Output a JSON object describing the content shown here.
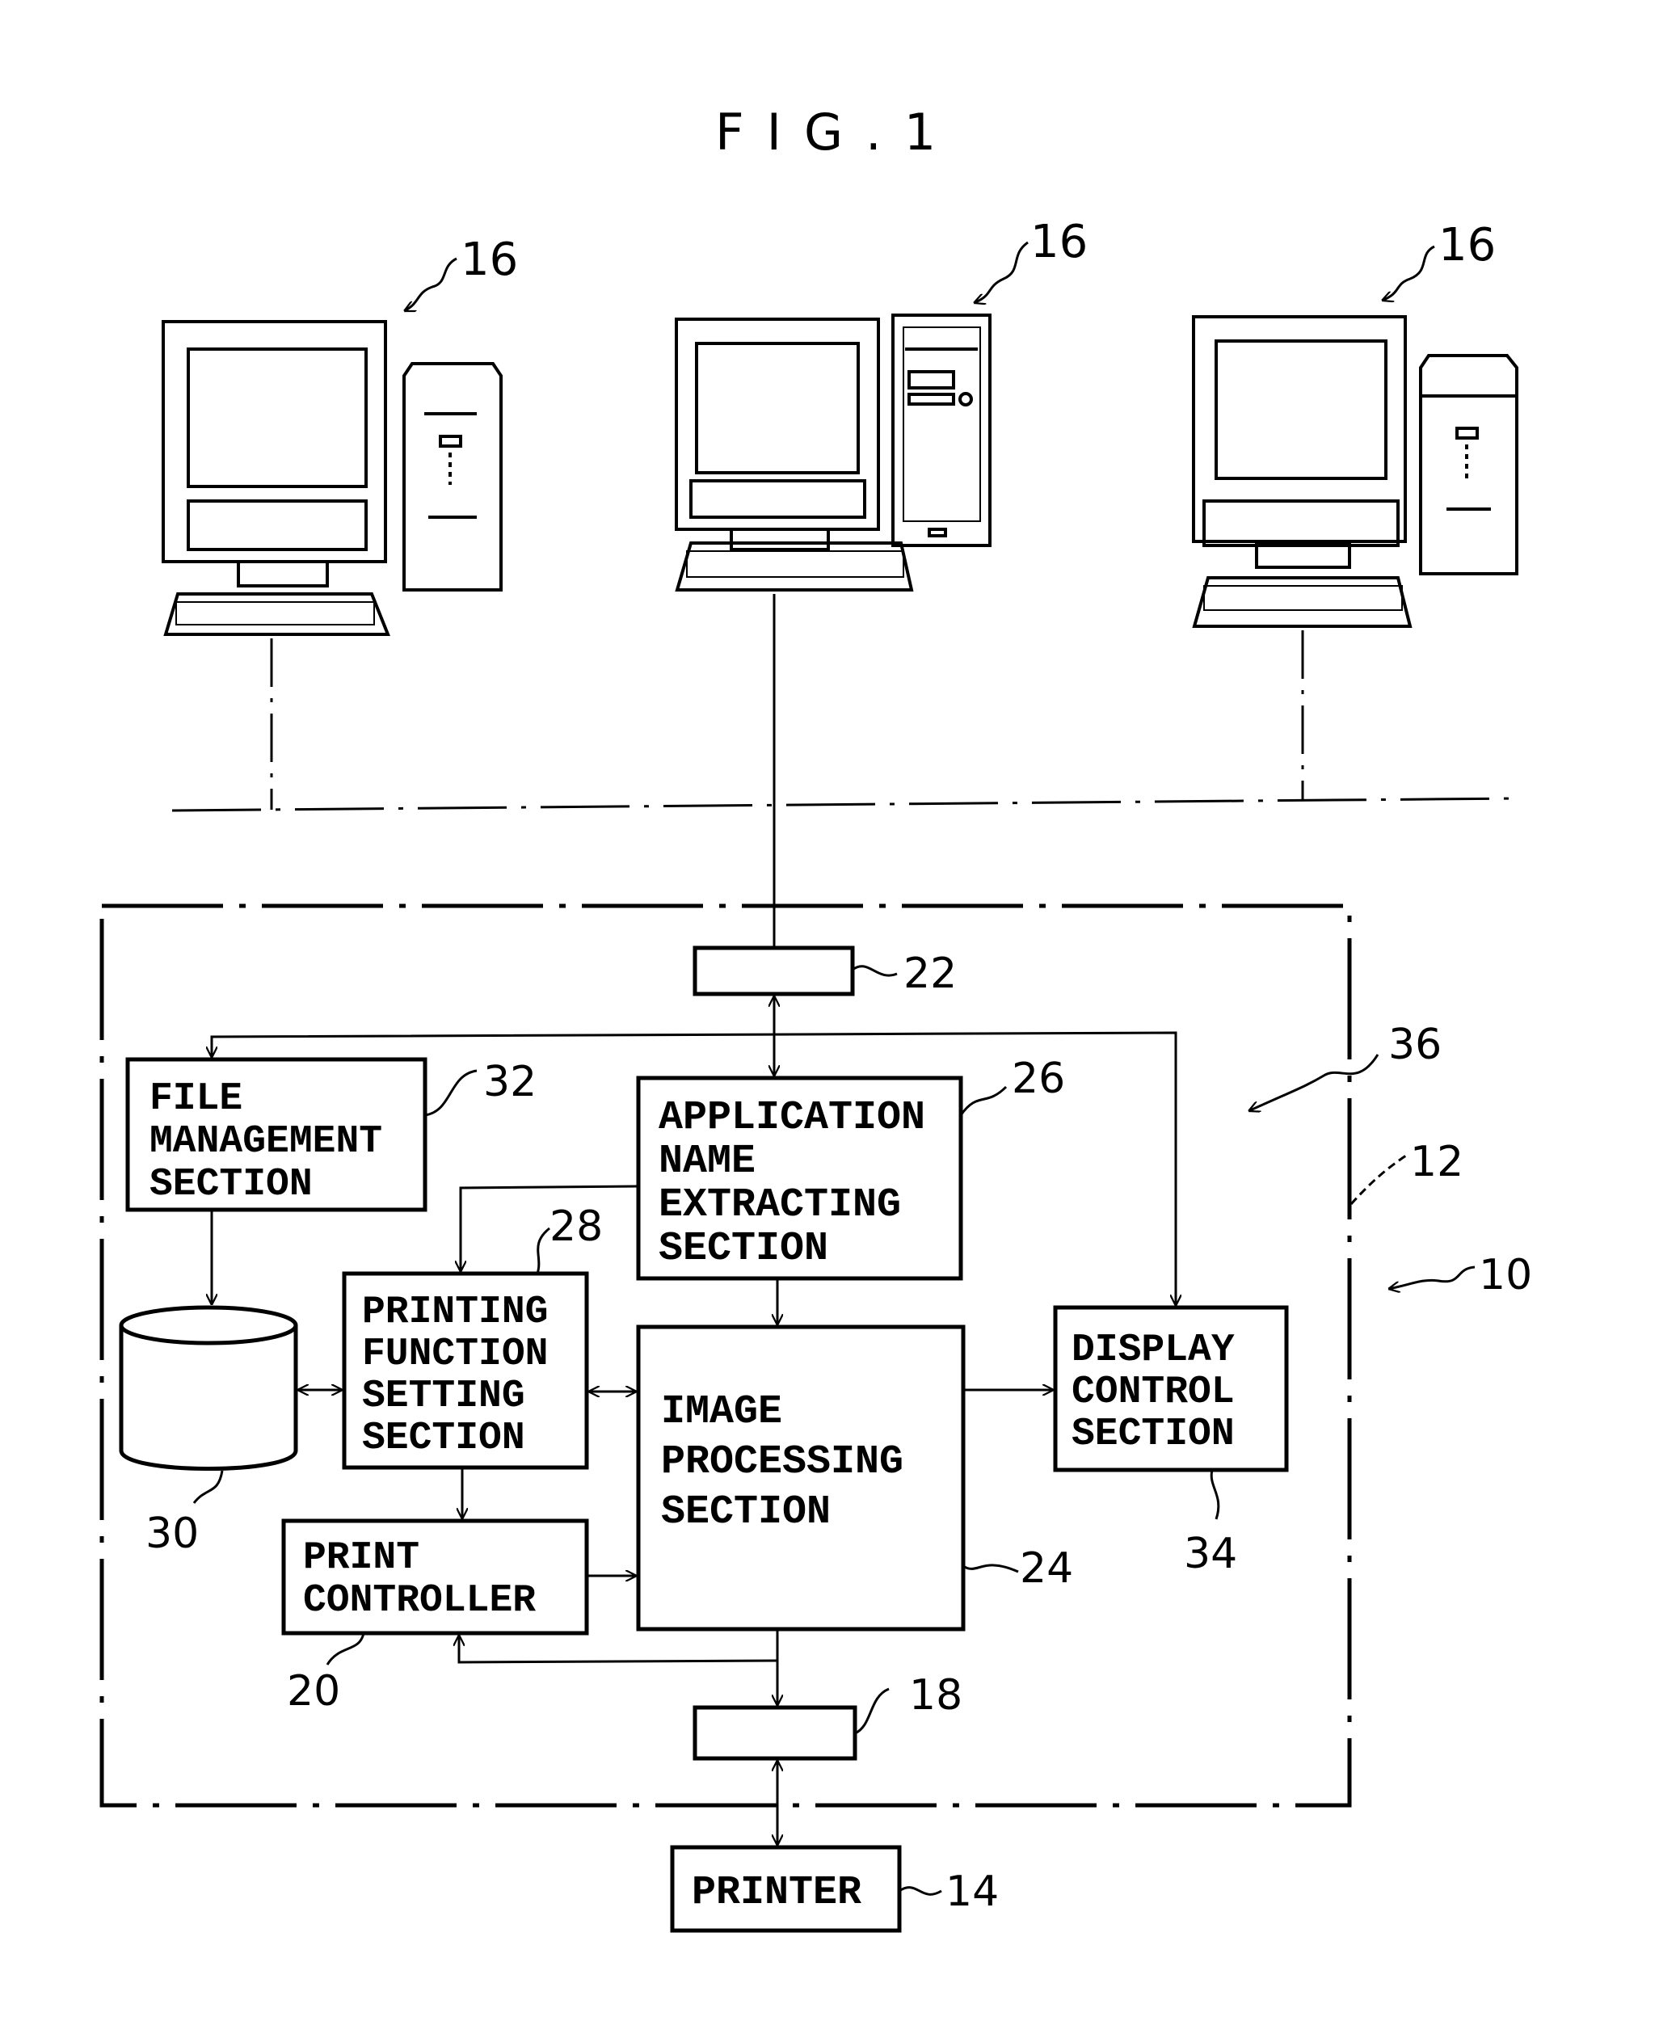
{
  "figure": {
    "title": "FIG.1"
  },
  "computers": [
    {
      "ref": "16"
    },
    {
      "ref": "16"
    },
    {
      "ref": "16"
    }
  ],
  "blocks": {
    "interface_22": {
      "ref": "22"
    },
    "file_management": {
      "lines": [
        "FILE",
        "MANAGEMENT",
        "SECTION"
      ],
      "ref": "32"
    },
    "application_name": {
      "lines": [
        "APPLICATION",
        "NAME",
        "EXTRACTING",
        "SECTION"
      ],
      "ref": "26"
    },
    "printing_function": {
      "lines": [
        "PRINTING",
        "FUNCTION",
        "SETTING",
        "SECTION"
      ],
      "ref": "28"
    },
    "image_processing": {
      "lines": [
        "IMAGE",
        "PROCESSING",
        "SECTION"
      ],
      "ref": "24"
    },
    "display_control": {
      "lines": [
        "DISPLAY",
        "CONTROL",
        "SECTION"
      ],
      "ref": "34"
    },
    "storage": {
      "ref": "30"
    },
    "print_controller": {
      "lines": [
        "PRINT",
        "CONTROLLER"
      ],
      "ref": "20"
    },
    "interface_18": {
      "ref": "18"
    },
    "printer": {
      "lines": [
        "PRINTER"
      ],
      "ref": "14"
    }
  },
  "refs": {
    "controller_group": "36",
    "housing": "12",
    "system": "10"
  }
}
